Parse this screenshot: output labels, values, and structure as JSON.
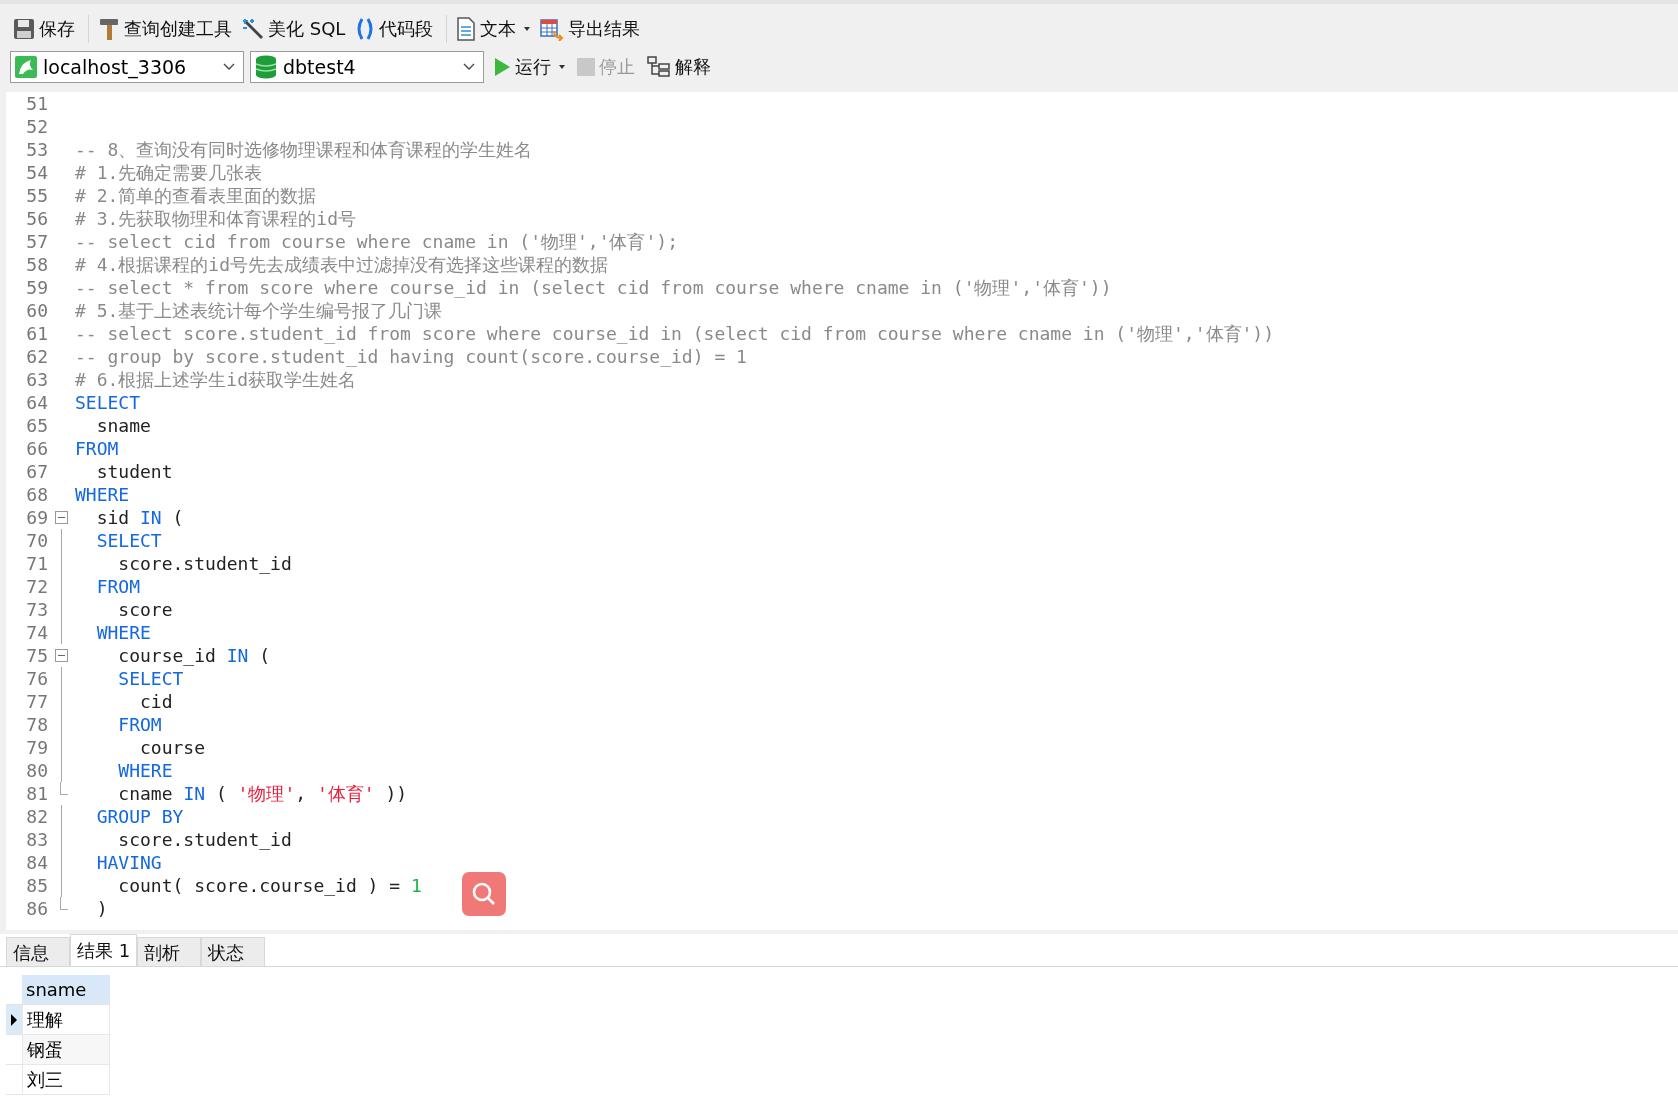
{
  "toolbar": {
    "buttons": [
      {
        "label": "保存",
        "kind": "save",
        "separator_before": false,
        "dropdown": false
      },
      {
        "label": "查询创建工具",
        "kind": "builder",
        "separator_before": true,
        "dropdown": false
      },
      {
        "label": "美化 SQL",
        "kind": "beautify",
        "separator_before": false,
        "dropdown": false
      },
      {
        "label": "代码段",
        "kind": "snippet",
        "separator_before": false,
        "dropdown": false
      },
      {
        "label": "文本",
        "kind": "text",
        "separator_before": true,
        "dropdown": true
      },
      {
        "label": "导出结果",
        "kind": "export",
        "separator_before": false,
        "dropdown": false
      }
    ]
  },
  "connection": {
    "value": "localhost_3306"
  },
  "database": {
    "value": "dbtest4"
  },
  "actions": [
    {
      "label": "运行",
      "kind": "run",
      "dropdown": true,
      "disabled": false
    },
    {
      "label": "停止",
      "kind": "stop",
      "dropdown": false,
      "disabled": true
    },
    {
      "label": "解释",
      "kind": "explain",
      "dropdown": false,
      "disabled": false
    }
  ],
  "editor": {
    "lines": [
      {
        "number": "51"
      },
      {
        "number": "52"
      },
      {
        "number": "53",
        "segments": [
          {
            "kind": "comment",
            "text": "-- 8、查询没有同时选修物理课程和体育课程的学生姓名"
          }
        ]
      },
      {
        "number": "54",
        "segments": [
          {
            "kind": "comment",
            "text": "# 1.先确定需要几张表"
          }
        ]
      },
      {
        "number": "55",
        "segments": [
          {
            "kind": "comment",
            "text": "# 2.简单的查看表里面的数据"
          }
        ]
      },
      {
        "number": "56",
        "segments": [
          {
            "kind": "comment",
            "text": "# 3.先获取物理和体育课程的id号"
          }
        ]
      },
      {
        "number": "57",
        "segments": [
          {
            "kind": "comment",
            "text": "-- select cid from course where cname in ('物理','体育');"
          }
        ]
      },
      {
        "number": "58",
        "segments": [
          {
            "kind": "comment",
            "text": "# 4.根据课程的id号先去成绩表中过滤掉没有选择这些课程的数据"
          }
        ]
      },
      {
        "number": "59",
        "segments": [
          {
            "kind": "comment",
            "text": "-- select * from score where course_id in (select cid from course where cname in ('物理','体育'))"
          }
        ]
      },
      {
        "number": "60",
        "segments": [
          {
            "kind": "comment",
            "text": "# 5.基于上述表统计每个学生编号报了几门课"
          }
        ]
      },
      {
        "number": "61",
        "segments": [
          {
            "kind": "comment",
            "text": "-- select score.student_id from score where course_id in (select cid from course where cname in ('物理','体育'))"
          }
        ]
      },
      {
        "number": "62",
        "segments": [
          {
            "kind": "comment",
            "text": "-- group by score.student_id having count(score.course_id) = 1"
          }
        ]
      },
      {
        "number": "63",
        "segments": [
          {
            "kind": "comment",
            "text": "# 6.根据上述学生id获取学生姓名"
          }
        ]
      },
      {
        "number": "64",
        "segments": [
          {
            "kind": "keyword",
            "text": "SELECT"
          }
        ]
      },
      {
        "number": "65",
        "segments": [
          {
            "kind": "plain",
            "text": "  sname"
          }
        ]
      },
      {
        "number": "66",
        "segments": [
          {
            "kind": "keyword",
            "text": "FROM"
          }
        ]
      },
      {
        "number": "67",
        "segments": [
          {
            "kind": "plain",
            "text": "  student"
          }
        ]
      },
      {
        "number": "68",
        "segments": [
          {
            "kind": "keyword",
            "text": "WHERE"
          }
        ]
      },
      {
        "number": "69",
        "kind": "fold_start",
        "segments": [
          {
            "kind": "plain",
            "text": "  sid "
          },
          {
            "kind": "keyword",
            "text": "IN"
          },
          {
            "kind": "plain",
            "text": " ("
          }
        ]
      },
      {
        "number": "70",
        "kind": "fold_guide",
        "segments": [
          {
            "kind": "keyword",
            "text": "  SELECT"
          }
        ]
      },
      {
        "number": "71",
        "kind": "fold_guide",
        "segments": [
          {
            "kind": "plain",
            "text": "    score.student_id"
          }
        ]
      },
      {
        "number": "72",
        "kind": "fold_guide",
        "segments": [
          {
            "kind": "keyword",
            "text": "  FROM"
          }
        ]
      },
      {
        "number": "73",
        "kind": "fold_guide",
        "segments": [
          {
            "kind": "plain",
            "text": "    score"
          }
        ]
      },
      {
        "number": "74",
        "kind": "fold_guide",
        "segments": [
          {
            "kind": "keyword",
            "text": "  WHERE"
          }
        ]
      },
      {
        "number": "75",
        "kind": "fold_start",
        "segments": [
          {
            "kind": "plain",
            "text": "    course_id "
          },
          {
            "kind": "keyword",
            "text": "IN"
          },
          {
            "kind": "plain",
            "text": " ("
          }
        ]
      },
      {
        "number": "76",
        "kind": "fold_guide",
        "segments": [
          {
            "kind": "keyword",
            "text": "    SELECT"
          }
        ]
      },
      {
        "number": "77",
        "kind": "fold_guide",
        "segments": [
          {
            "kind": "plain",
            "text": "      cid"
          }
        ]
      },
      {
        "number": "78",
        "kind": "fold_guide",
        "segments": [
          {
            "kind": "keyword",
            "text": "    FROM"
          }
        ]
      },
      {
        "number": "79",
        "kind": "fold_guide",
        "segments": [
          {
            "kind": "plain",
            "text": "      course"
          }
        ]
      },
      {
        "number": "80",
        "kind": "fold_guide",
        "segments": [
          {
            "kind": "keyword",
            "text": "    WHERE"
          }
        ]
      },
      {
        "number": "81",
        "kind": "fold_end",
        "segments": [
          {
            "kind": "plain",
            "text": "    cname "
          },
          {
            "kind": "keyword",
            "text": "IN"
          },
          {
            "kind": "plain",
            "text": " ( "
          },
          {
            "kind": "string",
            "text": "'物理'"
          },
          {
            "kind": "plain",
            "text": ", "
          },
          {
            "kind": "string",
            "text": "'体育'"
          },
          {
            "kind": "plain",
            "text": " ))"
          }
        ]
      },
      {
        "number": "82",
        "kind": "fold_guide",
        "segments": [
          {
            "kind": "keyword",
            "text": "  GROUP BY"
          }
        ]
      },
      {
        "number": "83",
        "kind": "fold_guide",
        "segments": [
          {
            "kind": "plain",
            "text": "    score.student_id"
          }
        ]
      },
      {
        "number": "84",
        "kind": "fold_guide",
        "segments": [
          {
            "kind": "keyword",
            "text": "  HAVING"
          }
        ]
      },
      {
        "number": "85",
        "kind": "fold_guide",
        "segments": [
          {
            "kind": "plain",
            "text": "    count( score.course_id ) = "
          },
          {
            "kind": "number",
            "text": "1"
          }
        ]
      },
      {
        "number": "86",
        "kind": "fold_end",
        "segments": [
          {
            "kind": "plain",
            "text": "  )"
          }
        ]
      }
    ]
  },
  "result_tabs": [
    {
      "label": "信息",
      "selected": false
    },
    {
      "label": "结果 1",
      "selected": true
    },
    {
      "label": "剖析",
      "selected": false
    },
    {
      "label": "状态",
      "selected": false
    }
  ],
  "grid": {
    "columns": [
      "sname"
    ],
    "rows": [
      {
        "cells": [
          "理解"
        ],
        "selected": true
      },
      {
        "cells": [
          "钢蛋"
        ],
        "selected": false
      },
      {
        "cells": [
          "刘三"
        ],
        "selected": false
      }
    ]
  }
}
